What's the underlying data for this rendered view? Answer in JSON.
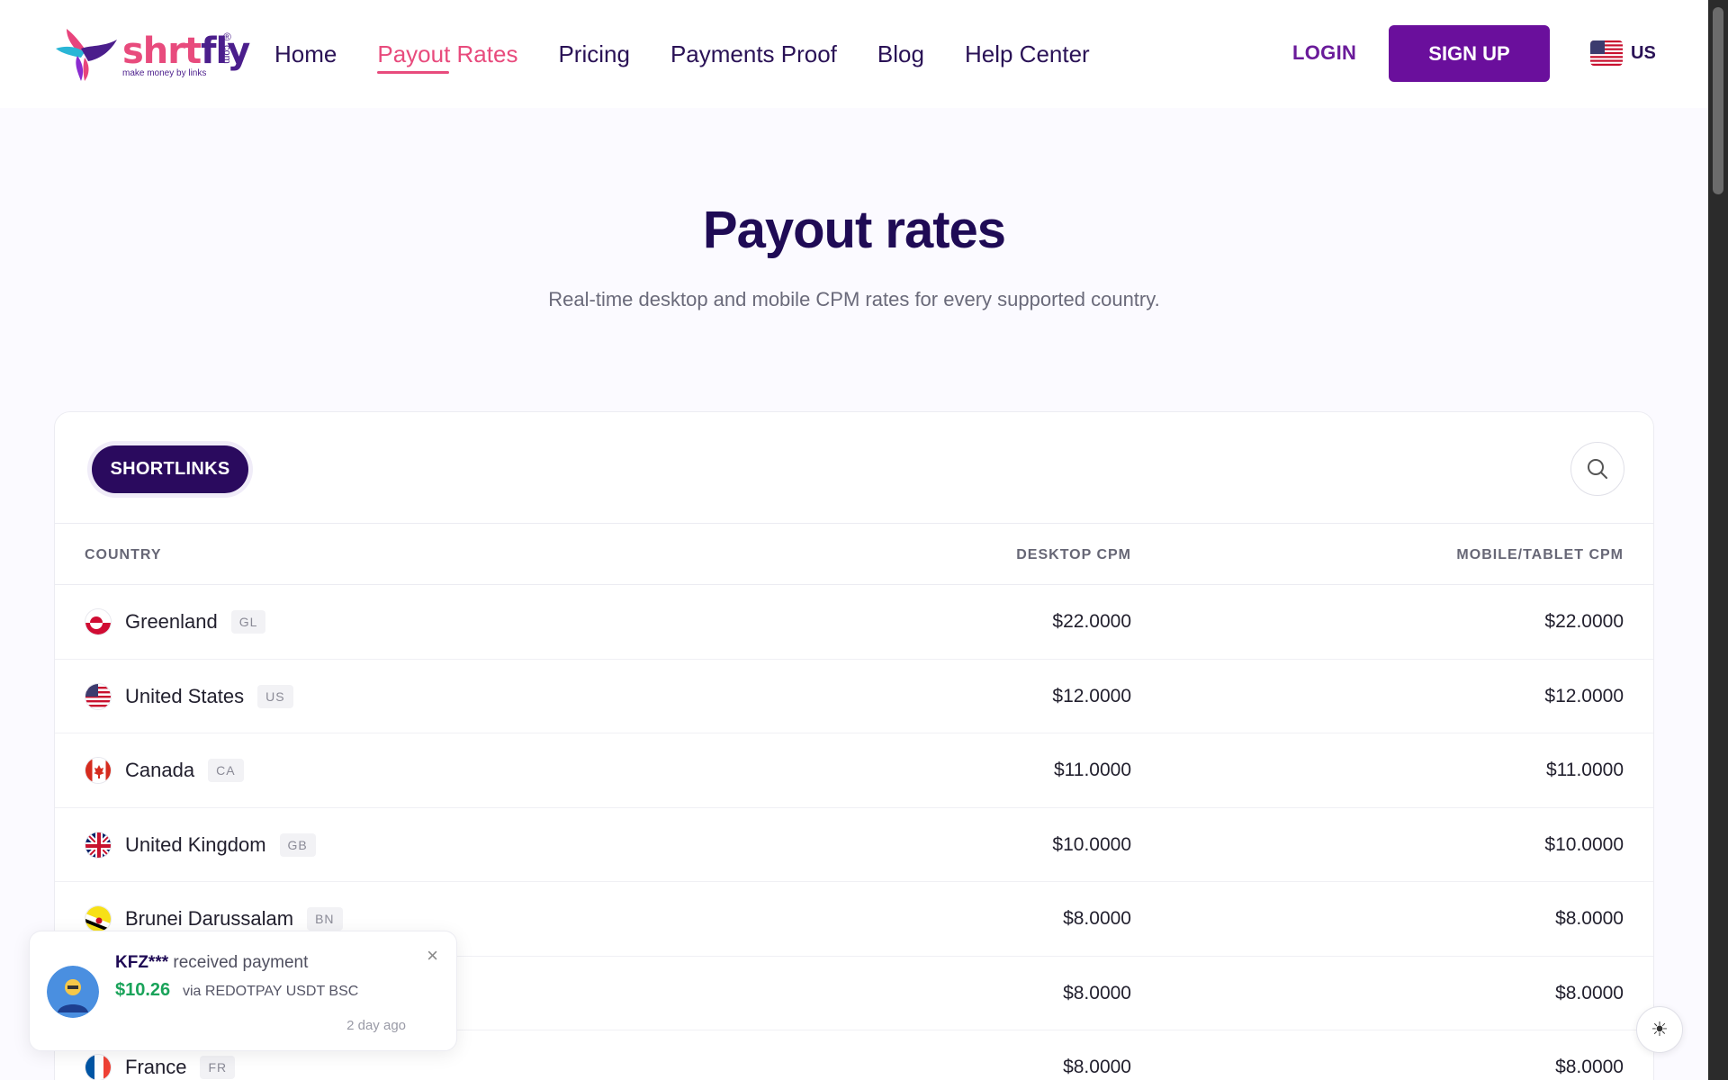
{
  "brand": {
    "logo_text_1": "shrt",
    "logo_text_2": "fly",
    "tagline": "make money by links",
    "reg": "®",
    "com": "com"
  },
  "nav": {
    "items": [
      {
        "label": "Home"
      },
      {
        "label": "Payout Rates",
        "active": true
      },
      {
        "label": "Pricing"
      },
      {
        "label": "Payments Proof"
      },
      {
        "label": "Blog"
      },
      {
        "label": "Help Center"
      }
    ],
    "login": "LOGIN",
    "signup": "SIGN UP",
    "lang": "US"
  },
  "hero": {
    "title": "Payout rates",
    "subtitle": "Real-time desktop and mobile CPM rates for every supported country."
  },
  "table": {
    "tab": "SHORTLINKS",
    "headers": {
      "country": "COUNTRY",
      "desktop": "DESKTOP CPM",
      "mobile": "MOBILE/TABLET CPM"
    },
    "rows": [
      {
        "country": "Greenland",
        "code": "GL",
        "desktop": "$22.0000",
        "mobile": "$22.0000"
      },
      {
        "country": "United States",
        "code": "US",
        "desktop": "$12.0000",
        "mobile": "$12.0000"
      },
      {
        "country": "Canada",
        "code": "CA",
        "desktop": "$11.0000",
        "mobile": "$11.0000"
      },
      {
        "country": "United Kingdom",
        "code": "GB",
        "desktop": "$10.0000",
        "mobile": "$10.0000"
      },
      {
        "country": "Brunei Darussalam",
        "code": "BN",
        "desktop": "$8.0000",
        "mobile": "$8.0000"
      },
      {
        "country": "",
        "code": "",
        "desktop": "$8.0000",
        "mobile": "$8.0000"
      },
      {
        "country": "France",
        "code": "FR",
        "desktop": "$8.0000",
        "mobile": "$8.0000"
      }
    ]
  },
  "toast": {
    "user": "KFZ***",
    "message": "received payment",
    "amount": "$10.26",
    "via": "via REDOTPAY USDT BSC",
    "time": "2 day ago",
    "close": "×"
  },
  "theme_toggle": "☀",
  "colors": {
    "accent": "#e84b7d",
    "brand_purple": "#6a0f9c",
    "dark_navy": "#1f0b55",
    "success": "#1aa35a"
  }
}
